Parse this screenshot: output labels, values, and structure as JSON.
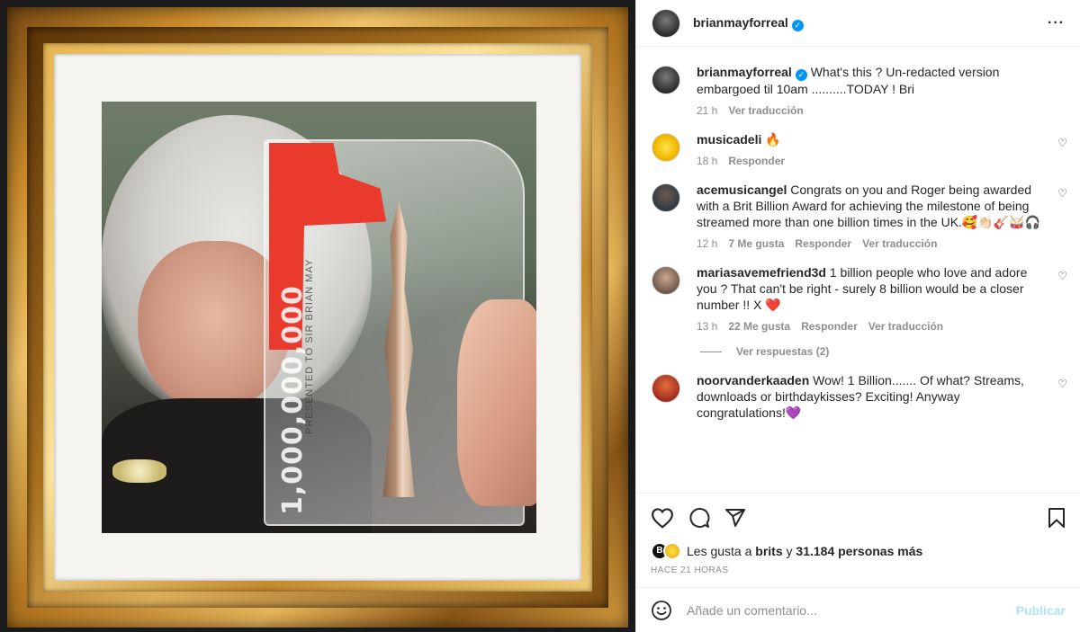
{
  "post": {
    "username": "brianmayforreal",
    "verified": true,
    "more_icon": "more-horizontal-icon"
  },
  "media": {
    "trophy_number": "1,000,000,000",
    "trophy_engraving": "PRESENTED TO SIR BRIAN MAY"
  },
  "caption": {
    "username": "brianmayforreal",
    "text": "What's this ? Un-redacted version embargoed til 10am ..........TODAY ! Bri",
    "time": "21 h",
    "translate": "Ver traducción"
  },
  "comments": [
    {
      "username": "musicadeli",
      "text": "🔥",
      "time": "18 h",
      "likes": "",
      "reply": "Responder",
      "translate": ""
    },
    {
      "username": "acemusicangel",
      "text": "Congrats on you and Roger being awarded with a Brit Billion Award for achieving the milestone of being streamed more than one billion times in the UK.🥰👏🏻🎸🥁🎧",
      "time": "12 h",
      "likes": "7 Me gusta",
      "reply": "Responder",
      "translate": "Ver traducción"
    },
    {
      "username": "mariasavemefriend3d",
      "text": "1 billion people who love and adore you ? That can't be right - surely 8 billion would be a closer number !! X ❤️",
      "time": "13 h",
      "likes": "22 Me gusta",
      "reply": "Responder",
      "translate": "Ver traducción",
      "view_replies": "Ver respuestas (2)"
    },
    {
      "username": "noorvanderkaaden",
      "text": "Wow! 1 Billion....... Of what? Streams, downloads or birthdaykisses? Exciting! Anyway congratulations!💜",
      "time": "",
      "likes": "",
      "reply": "",
      "translate": ""
    }
  ],
  "actions": {
    "likes_prefix": "Les gusta a",
    "likes_user": "brits",
    "likes_and": "y",
    "likes_count": "31.184 personas más",
    "posted_ago": "HACE 21 HORAS",
    "mini_avatar_letter": "B"
  },
  "add_comment": {
    "placeholder": "Añade un comentario...",
    "publish": "Publicar"
  },
  "colors": {
    "verified_blue": "#0095f6",
    "redaction_red": "#ea3a2e",
    "publish_disabled": "#b2dffc"
  }
}
